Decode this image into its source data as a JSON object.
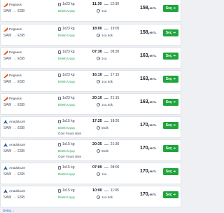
{
  "flights": [
    {
      "airline": "Pegasus",
      "logo": "pegasus-logo",
      "route_from": "SAW",
      "route_to": "ESB",
      "baggage": "1x23 kg",
      "direct": "Direkt Uçuş",
      "extra": "",
      "depart": "11:30",
      "arrive": "12:30",
      "duration": "1sa",
      "price_main": "158,",
      "price_cents": "99 TL",
      "select": "Seç ➔",
      "details": "Detay"
    },
    {
      "airline": "Pegasus",
      "logo": "pegasus-logo",
      "route_from": "SAW",
      "route_to": "ESB",
      "baggage": "1x23 kg",
      "direct": "Direkt Uçuş",
      "extra": "",
      "depart": "18:00",
      "arrive": "19:05",
      "duration": "1sa 5dk",
      "price_main": "158,",
      "price_cents": "99 TL",
      "select": "Seç ➔",
      "details": "Detay"
    },
    {
      "airline": "Pegasus",
      "logo": "pegasus-logo",
      "route_from": "SAW",
      "route_to": "ESB",
      "baggage": "1x23 kg",
      "direct": "Direkt Uçuş",
      "extra": "",
      "depart": "07:30",
      "arrive": "08:30",
      "duration": "1sa",
      "price_main": "163,",
      "price_cents": "99 TL",
      "select": "Seç ➔",
      "details": "Detay"
    },
    {
      "airline": "Pegasus",
      "logo": "pegasus-logo",
      "route_from": "SAW",
      "route_to": "ESB",
      "baggage": "1x23 kg",
      "direct": "Direkt Uçuş",
      "extra": "",
      "depart": "16:10",
      "arrive": "17:15",
      "duration": "1sa 5dk",
      "price_main": "163,",
      "price_cents": "99 TL",
      "select": "Seç ➔",
      "details": "Detay"
    },
    {
      "airline": "Pegasus",
      "logo": "pegasus-logo",
      "route_from": "SAW",
      "route_to": "ESB",
      "baggage": "1x23 kg",
      "direct": "Direkt Uçuş",
      "extra": "",
      "depart": "20:10",
      "arrive": "21:15",
      "duration": "1sa 5dk",
      "price_main": "163,",
      "price_cents": "99 TL",
      "select": "Seç ➔",
      "details": "Detay"
    },
    {
      "airline": "AnadoluJet",
      "logo": "anadolujet-logo",
      "route_from": "SAW",
      "route_to": "ESB",
      "baggage": "1x15 kg",
      "direct": "Direkt Uçuş",
      "extra": "Özel Fiyatlı Bilet",
      "depart": "17:25",
      "arrive": "18:20",
      "duration": "55dk",
      "price_main": "170,",
      "price_cents": "99 TL",
      "select": "Seç ➔",
      "details": "Detay"
    },
    {
      "airline": "AnadoluJet",
      "logo": "anadolujet-logo",
      "route_from": "SAW",
      "route_to": "ESB",
      "baggage": "1x15 kg",
      "direct": "Direkt Uçuş",
      "extra": "Özel Fiyatlı Bilet",
      "depart": "20:35",
      "arrive": "21:30",
      "duration": "55dk",
      "price_main": "170,",
      "price_cents": "99 TL",
      "select": "Seç ➔",
      "details": "Detay"
    },
    {
      "airline": "AnadoluJet",
      "logo": "anadolujet-logo",
      "route_from": "SAW",
      "route_to": "ESB",
      "baggage": "1x15 kg",
      "direct": "Direkt Uçuş",
      "extra": "",
      "depart": "07:00",
      "arrive": "08:00",
      "duration": "1sa",
      "price_main": "170,",
      "price_cents": "99 TL",
      "select": "Seç ➔",
      "details": "Detay"
    },
    {
      "airline": "AnadoluJet",
      "logo": "anadolujet-logo",
      "route_from": "SAW",
      "route_to": "ESB",
      "baggage": "1x15 kg",
      "direct": "Direkt Uçuş",
      "extra": "",
      "depart": "10:00",
      "arrive": "11:05",
      "duration": "1sa 5dk",
      "price_main": "170,",
      "price_cents": "99 TL",
      "select": "Seç ➔",
      "details": "Detay"
    }
  ],
  "colors": {
    "select_button": "#1fa53b",
    "direct": "#16a34a",
    "details_link": "#2563eb"
  }
}
